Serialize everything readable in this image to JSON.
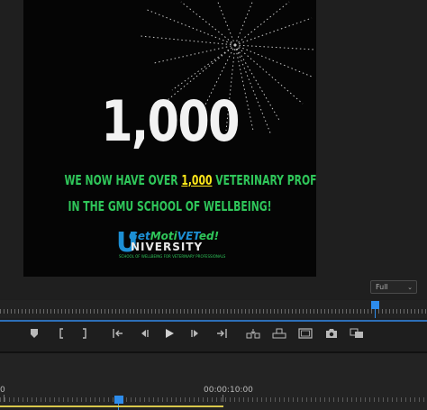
{
  "preview": {
    "big_number": "1,000",
    "caption_line1_pre": "WE NOW HAVE OVER ",
    "caption_line1_highlight": "1,000",
    "caption_line1_post": " VETERINARY PROFESSIONALS",
    "caption_line2": "IN THE GMU SCHOOL OF WELLBEING!",
    "logo": {
      "u": "U",
      "get": "Get",
      "moti": "Moti",
      "vet": "VET",
      "ed": "ed!",
      "university": "NIVERSITY",
      "subtitle": "SCHOOL OF WELLBEING FOR VETERINARY PROFESSIONALS"
    },
    "colors": {
      "green": "#2fc65a",
      "yellow": "#ffe81a",
      "blue": "#1d8fd4"
    }
  },
  "monitor": {
    "zoom_value": "Full"
  },
  "transport": {
    "buttons": [
      "add-marker",
      "mark-in",
      "mark-out",
      "go-to-in",
      "step-back",
      "play",
      "step-forward",
      "go-to-out",
      "insert",
      "overwrite",
      "safe-margins",
      "export-frame",
      "comparison-view"
    ]
  },
  "timeline": {
    "start_timecode": "0",
    "mark_timecode": "00:00:10:00"
  },
  "accent_color": "#2d8ceb"
}
